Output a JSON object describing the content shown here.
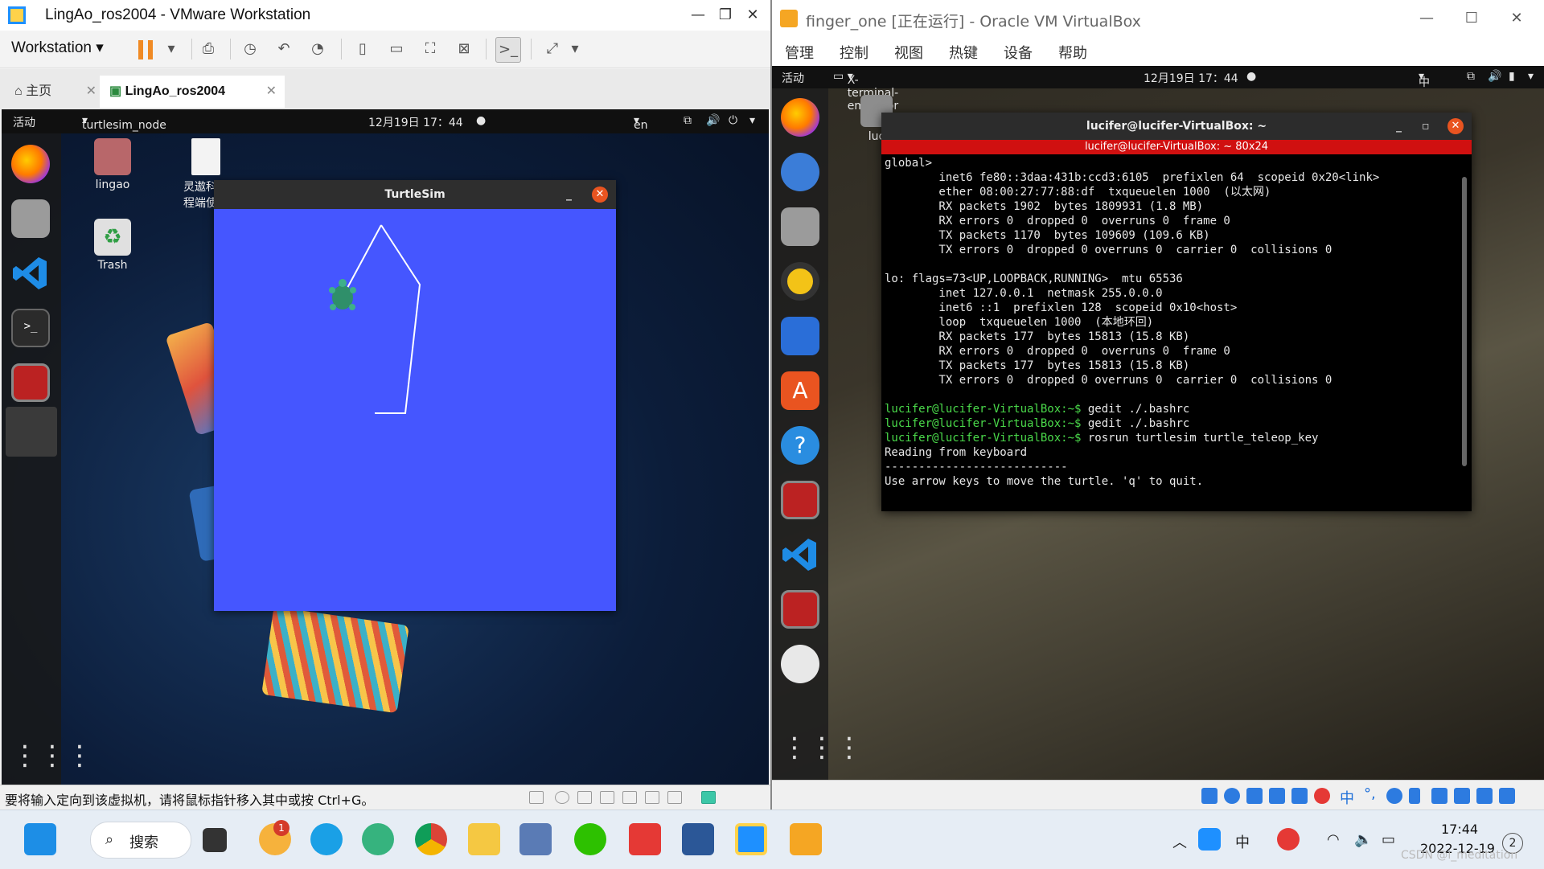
{
  "vmware": {
    "title": "LingAo_ros2004 - VMware Workstation",
    "menu_label": "Workstation",
    "tabs": [
      {
        "label": "主页"
      },
      {
        "label": "LingAo_ros2004"
      }
    ],
    "status_msg": "要将输入定向到该虚拟机，请将鼠标指针移入其中或按 Ctrl+G。",
    "guest": {
      "activities": "活动",
      "app_menu": "turtlesim_node",
      "clock": "12月19日  17：44",
      "lang": "en",
      "desktop_icons": [
        {
          "label": "lingao"
        },
        {
          "label": "Trash"
        },
        {
          "label": "灵遨科技"
        },
        {
          "label": "程端使用"
        }
      ],
      "turtlesim": {
        "title": "TurtleSim",
        "trail_color": "#ffffff",
        "bg_color": "#4556ff"
      }
    }
  },
  "vbox": {
    "title": "finger_one [正在运行] - Oracle VM VirtualBox",
    "menu": [
      "管理",
      "控制",
      "视图",
      "热键",
      "设备",
      "帮助"
    ],
    "guest": {
      "activities": "活动",
      "app_menu": "X-terminal-emulator",
      "clock": "12月19日  17：44",
      "input": "中",
      "desktop_icon_label": "luc",
      "terminal": {
        "title": "lucifer@lucifer-VirtualBox: ~",
        "subtitle": "lucifer@lucifer-VirtualBox: ~ 80x24",
        "lines": [
          {
            "type": "out",
            "text": "global>"
          },
          {
            "type": "out",
            "text": "        inet6 fe80::3daa:431b:ccd3:6105  prefixlen 64  scopeid 0x20<link>"
          },
          {
            "type": "out",
            "text": "        ether 08:00:27:77:88:df  txqueuelen 1000  (以太网)"
          },
          {
            "type": "out",
            "text": "        RX packets 1902  bytes 1809931 (1.8 MB)"
          },
          {
            "type": "out",
            "text": "        RX errors 0  dropped 0  overruns 0  frame 0"
          },
          {
            "type": "out",
            "text": "        TX packets 1170  bytes 109609 (109.6 KB)"
          },
          {
            "type": "out",
            "text": "        TX errors 0  dropped 0 overruns 0  carrier 0  collisions 0"
          },
          {
            "type": "out",
            "text": ""
          },
          {
            "type": "out",
            "text": "lo: flags=73<UP,LOOPBACK,RUNNING>  mtu 65536"
          },
          {
            "type": "out",
            "text": "        inet 127.0.0.1  netmask 255.0.0.0"
          },
          {
            "type": "out",
            "text": "        inet6 ::1  prefixlen 128  scopeid 0x10<host>"
          },
          {
            "type": "out",
            "text": "        loop  txqueuelen 1000  (本地环回)"
          },
          {
            "type": "out",
            "text": "        RX packets 177  bytes 15813 (15.8 KB)"
          },
          {
            "type": "out",
            "text": "        RX errors 0  dropped 0  overruns 0  frame 0"
          },
          {
            "type": "out",
            "text": "        TX packets 177  bytes 15813 (15.8 KB)"
          },
          {
            "type": "out",
            "text": "        TX errors 0  dropped 0 overruns 0  carrier 0  collisions 0"
          },
          {
            "type": "out",
            "text": ""
          },
          {
            "type": "cmd",
            "prompt": "lucifer@lucifer-VirtualBox:~$",
            "text": " gedit ./.bashrc"
          },
          {
            "type": "cmd",
            "prompt": "lucifer@lucifer-VirtualBox:~$",
            "text": " gedit ./.bashrc"
          },
          {
            "type": "cmd",
            "prompt": "lucifer@lucifer-VirtualBox:~$",
            "text": " rosrun turtlesim turtle_teleop_key"
          },
          {
            "type": "out",
            "text": "Reading from keyboard"
          },
          {
            "type": "out",
            "text": "---------------------------"
          },
          {
            "type": "out",
            "text": "Use arrow keys to move the turtle. 'q' to quit."
          }
        ]
      }
    }
  },
  "taskbar": {
    "search_label": "搜索",
    "notification_badge": "1",
    "ime": "中",
    "time": "17:44",
    "date": "2022-12-19",
    "notify_count": "2",
    "watermark": "CSDN @i_meditation"
  },
  "colors": {
    "accent_orange": "#e95420",
    "vmware_pause": "#f08a24",
    "terminal_prompt": "#4ad94a",
    "terminal_subtitle_bg": "#d01010"
  }
}
